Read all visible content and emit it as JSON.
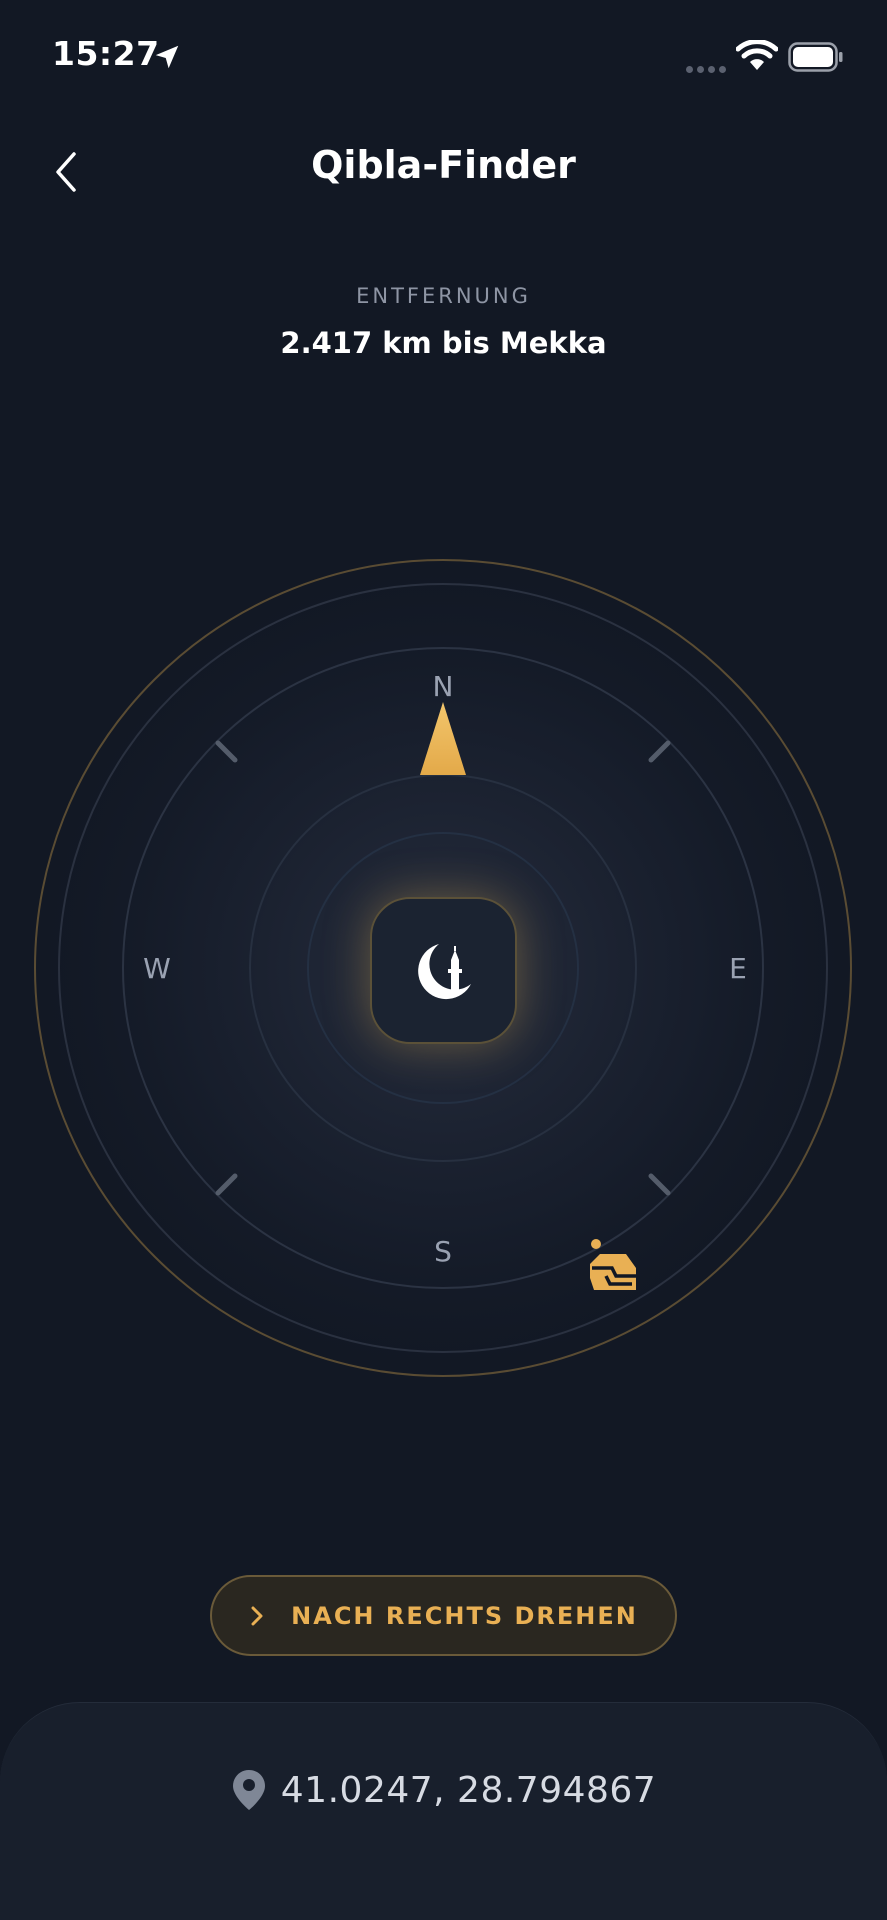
{
  "status_bar": {
    "time": "15:27",
    "icons": [
      "location-arrow-icon",
      "signal-dots-icon",
      "wifi-icon",
      "battery-icon"
    ]
  },
  "header": {
    "back_icon": "chevron-left-icon",
    "title": "Qibla-Finder"
  },
  "distance": {
    "label": "ENTFERNUNG",
    "value": "2.417 km bis Mekka"
  },
  "compass": {
    "north": "N",
    "east": "E",
    "south": "S",
    "west": "W",
    "center_icon": "crescent-mosque-icon",
    "qibla_marker_icon": "kaaba-icon",
    "accent_color": "#e9b054"
  },
  "turn_button": {
    "icon": "chevron-right-icon",
    "label": "NACH RECHTS DREHEN"
  },
  "location": {
    "icon": "location-pin-icon",
    "coords": "41.0247, 28.794867"
  },
  "colors": {
    "background": "#121824",
    "accent": "#e9b054",
    "muted_text": "#8e95a4"
  }
}
